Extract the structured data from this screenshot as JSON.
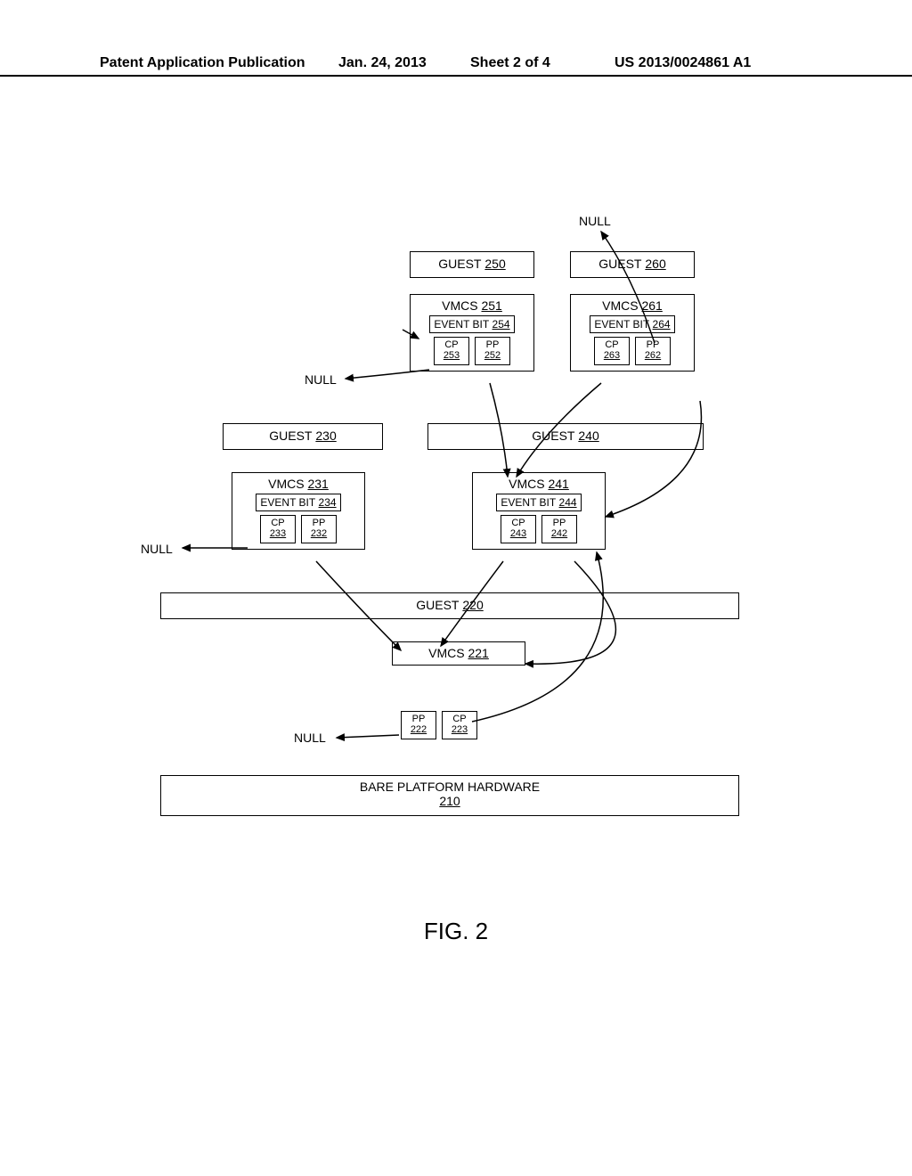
{
  "header": {
    "publication": "Patent Application Publication",
    "date": "Jan. 24, 2013",
    "sheet": "Sheet 2 of 4",
    "docnum": "US 2013/0024861 A1"
  },
  "labels": {
    "null": "NULL",
    "guest": "GUEST",
    "vmcs": "VMCS",
    "event_bit": "EVENT BIT",
    "cp": "CP",
    "pp": "PP",
    "bare_platform": "BARE PLATFORM HARDWARE"
  },
  "refs": {
    "guest250": "250",
    "guest260": "260",
    "vmcs251": "251",
    "event254": "254",
    "cp253": "253",
    "pp252": "252",
    "vmcs261": "261",
    "event264": "264",
    "cp263": "263",
    "pp262": "262",
    "guest230": "230",
    "guest240": "240",
    "vmcs231": "231",
    "event234": "234",
    "cp233": "233",
    "pp232": "232",
    "vmcs241": "241",
    "event244": "244",
    "cp243": "243",
    "pp242": "242",
    "guest220": "220",
    "vmcs221": "221",
    "pp222": "222",
    "cp223": "223",
    "platform210": "210"
  },
  "figure": "FIG. 2"
}
